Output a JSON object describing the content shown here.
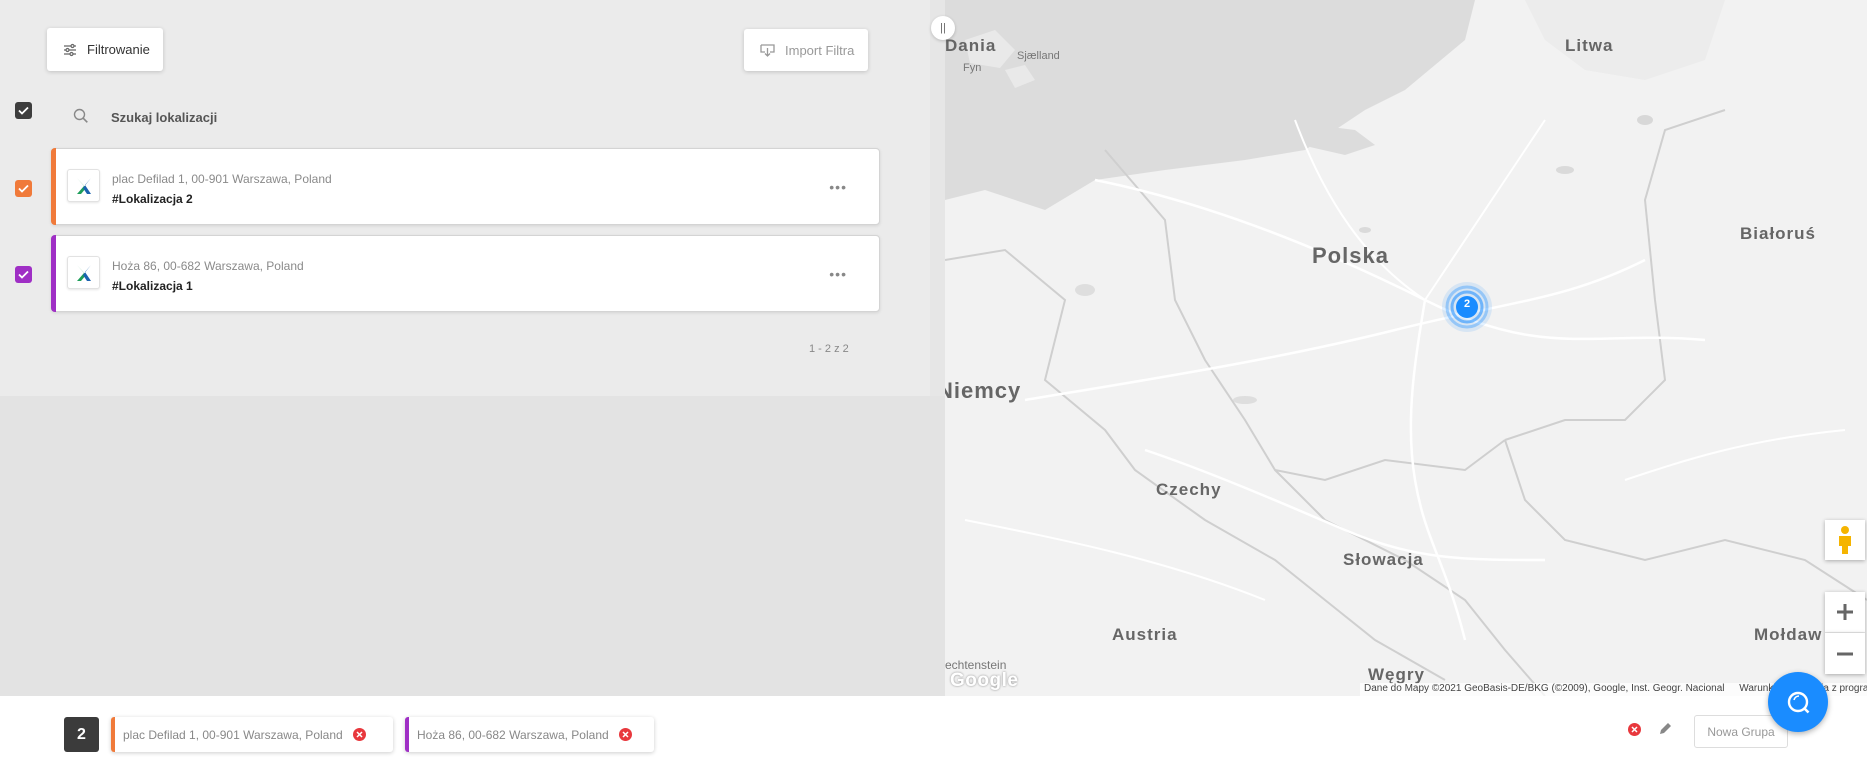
{
  "toolbar": {
    "filter_label": "Filtrowanie",
    "import_label": "Import Filtra"
  },
  "search": {
    "label": "Szukaj lokalizacji"
  },
  "locations": [
    {
      "address": "plac Defilad 1, 00-901 Warszawa, Poland",
      "name": "#Lokalizacja 2",
      "color": "#f07a3a",
      "checked": true
    },
    {
      "address": "Hoża 86, 00-682 Warszawa, Poland",
      "name": "#Lokalizacja 1",
      "color": "#9f2fc5",
      "checked": true
    }
  ],
  "pagination": {
    "text": "1 - 2 z 2"
  },
  "map": {
    "labels": {
      "dania": "Dania",
      "sjaelland": "Sjælland",
      "fyn": "Fyn",
      "litwa": "Litwa",
      "polska": "Polska",
      "bialorus": "Białoruś",
      "niemcy": "Niemcy",
      "czechy": "Czechy",
      "slowacja": "Słowacja",
      "austria": "Austria",
      "moldawia": "Mołdaw",
      "wegry": "Węgry",
      "liechtenstein": "echtenstein"
    },
    "cluster_count": "2",
    "cluster_color": "#1a8cff",
    "google_logo": "Google",
    "attribution": "Dane do Mapy ©2021 GeoBasis-DE/BKG (©2009), Google, Inst. Geogr. Nacional",
    "terms": "Warunki korzystania z programu"
  },
  "bottom_bar": {
    "count": "2",
    "chips": [
      {
        "label": "plac Defilad 1, 00-901 Warszawa, Poland",
        "color": "#f07a3a"
      },
      {
        "label": "Hoża 86, 00-682 Warszawa, Poland",
        "color": "#9f2fc5"
      }
    ],
    "new_group_label": "Nowa Grupa"
  },
  "icons": {
    "filter": "sliders-icon",
    "import": "download-icon",
    "search": "search-icon",
    "more": "more-horizontal-icon",
    "remove": "close-circle-icon",
    "edit": "pencil-icon",
    "fab": "search-icon",
    "pegman": "pegman-icon"
  }
}
